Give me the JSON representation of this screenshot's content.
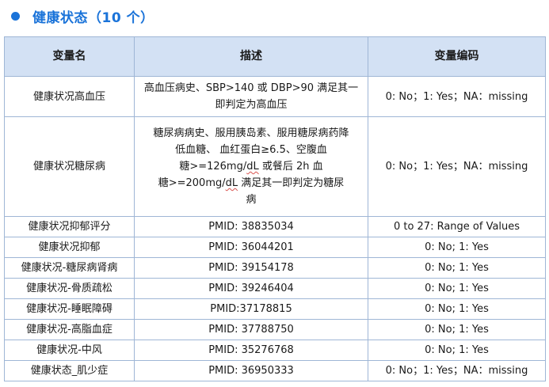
{
  "section": {
    "title": "健康状态（10 个）"
  },
  "table": {
    "headers": [
      "变量名",
      "描述",
      "变量编码"
    ],
    "rows": [
      {
        "name": "健康状况高血压",
        "desc": "高血压病史、SBP>140 或 DBP>90 满足其一即判定为高血压",
        "code": "0: No；1: Yes；NA：missing"
      },
      {
        "name": "健康状况糖尿病",
        "desc_lines": [
          "糖尿病病史、服用胰岛素、服用糖尿病药降",
          "低血糖、 血红蛋白≥6.5、空腹血",
          "糖>=126mg/dL 或餐后 2h 血",
          "糖>=200mg/dL 满足其一即判定为糖尿",
          "病"
        ],
        "code": "0: No；1: Yes；NA：missing"
      },
      {
        "name": "健康状况抑郁评分",
        "desc": "PMID: 38835034",
        "code": "0 to 27: Range of Values"
      },
      {
        "name": "健康状况抑郁",
        "desc": "PMID: 36044201",
        "code": "0: No; 1: Yes"
      },
      {
        "name": "健康状况-糖尿病肾病",
        "desc": "PMID: 39154178",
        "code": "0: No; 1: Yes"
      },
      {
        "name": "健康状况-骨质疏松",
        "desc": "PMID: 39246404",
        "code": "0: No; 1: Yes"
      },
      {
        "name": "健康状况-睡眠障碍",
        "desc": "PMID:37178815",
        "code": "0: No; 1: Yes"
      },
      {
        "name": "健康状况-高脂血症",
        "desc": "PMID: 37788750",
        "code": "0: No; 1: Yes"
      },
      {
        "name": "健康状况-中风",
        "desc": "PMID: 35276768",
        "code": "0: No; 1: Yes"
      },
      {
        "name": "健康状态_肌少症",
        "desc": "PMID: 36950333",
        "code": "0: No；1: Yes；NA：missing"
      }
    ]
  },
  "colors": {
    "accent": "#1a73d9",
    "header_bg": "#d3e1f4",
    "border": "#9fb6d6"
  }
}
